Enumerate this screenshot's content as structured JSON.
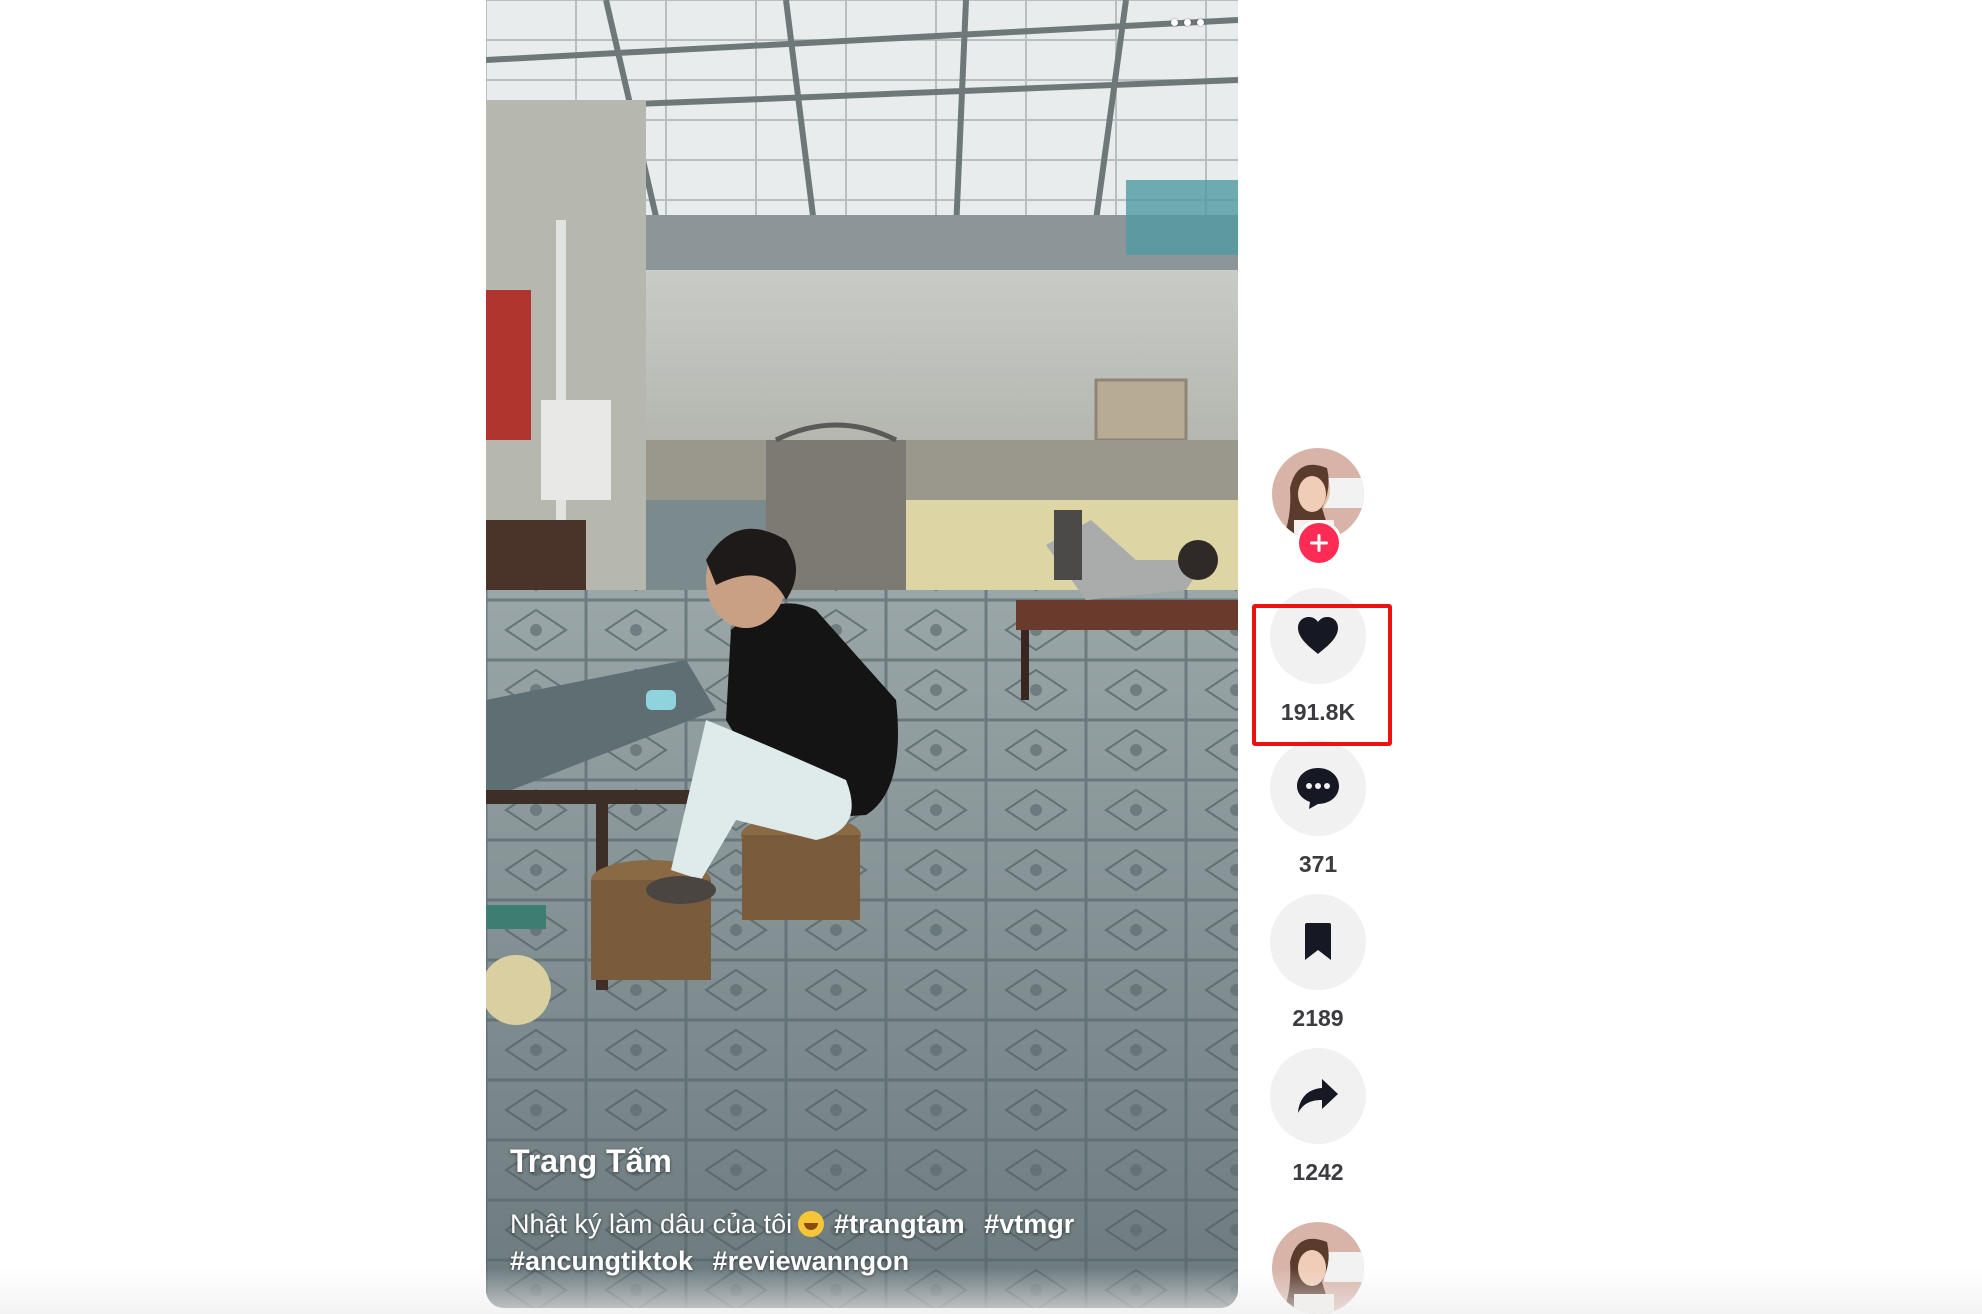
{
  "video": {
    "author_name": "Trang Tấm",
    "description_text": "Nhật ký làm dâu của tôi",
    "emoji_icon": "rolling-laughing-emoji-icon",
    "hashtags": [
      "#trangtam",
      "#vtmgr",
      "#ancungtiktok",
      "#reviewanngon"
    ]
  },
  "actions": {
    "like_count": "191.8K",
    "comment_count": "371",
    "save_count": "2189",
    "share_count": "1242"
  },
  "colors": {
    "follow_accent": "#fe2c55",
    "highlight": "#ee1111",
    "action_bg": "#f1f1f2",
    "icon_dark": "#161823"
  }
}
